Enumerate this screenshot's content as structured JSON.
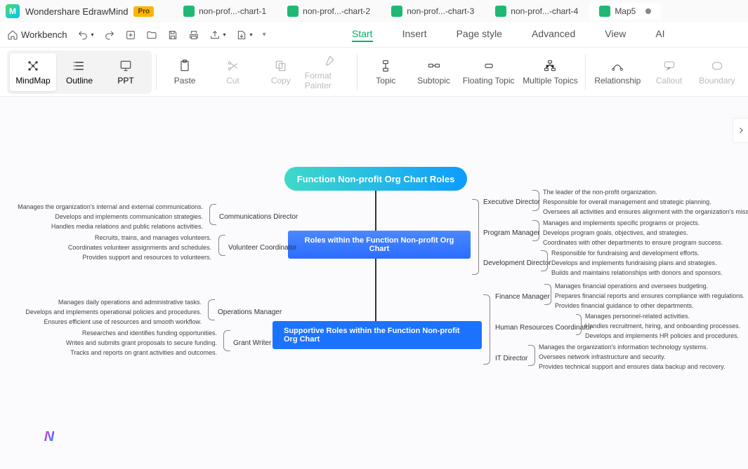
{
  "app": {
    "name": "Wondershare EdrawMind",
    "badge": "Pro"
  },
  "tabs": [
    {
      "label": "non-prof...-chart-1"
    },
    {
      "label": "non-prof...-chart-2"
    },
    {
      "label": "non-prof...-chart-3"
    },
    {
      "label": "non-prof...-chart-4"
    },
    {
      "label": "Map5",
      "active": true
    }
  ],
  "toolbar": {
    "workbench": "Workbench"
  },
  "menu": {
    "start": "Start",
    "insert": "Insert",
    "page_style": "Page style",
    "advanced": "Advanced",
    "view": "View",
    "ai": "AI"
  },
  "view_modes": {
    "mindmap": "MindMap",
    "outline": "Outline",
    "ppt": "PPT"
  },
  "ribbon": {
    "paste": "Paste",
    "cut": "Cut",
    "copy": "Copy",
    "format_painter": "Format Painter",
    "topic": "Topic",
    "subtopic": "Subtopic",
    "floating_topic": "Floating Topic",
    "multiple_topics": "Multiple Topics",
    "relationship": "Relationship",
    "callout": "Callout",
    "boundary": "Boundary"
  },
  "mindmap": {
    "root": "Function Non-profit Org Chart Roles",
    "branches": [
      {
        "title": "Roles within the Function Non-profit Org Chart",
        "left": [
          {
            "label": "Communications Director",
            "details": [
              "Manages the organization's internal and external communications.",
              "Develops and implements communication strategies.",
              "Handles media relations and public relations activities."
            ]
          },
          {
            "label": "Volunteer Coordinator",
            "details": [
              "Recruits, trains, and manages volunteers.",
              "Coordinates volunteer assignments and schedules.",
              "Provides support and resources to volunteers."
            ]
          }
        ],
        "right": [
          {
            "label": "Executive Director",
            "details": [
              "The leader of the non-profit organization.",
              "Responsible for overall management and strategic planning.",
              "Oversees all activities and ensures alignment with the organization's mission."
            ]
          },
          {
            "label": "Program Manager",
            "details": [
              "Manages and implements specific programs or projects.",
              "Develops program goals, objectives, and strategies.",
              "Coordinates with other departments to ensure program success."
            ]
          },
          {
            "label": "Development Director",
            "details": [
              "Responsible for fundraising and development efforts.",
              "Develops and implements fundraising plans and strategies.",
              "Builds and maintains relationships with donors and sponsors."
            ]
          }
        ]
      },
      {
        "title": "Supportive Roles within the Function Non-profit Org Chart",
        "left": [
          {
            "label": "Operations Manager",
            "details": [
              "Manages daily operations and administrative tasks.",
              "Develops and implements operational policies and procedures.",
              "Ensures efficient use of resources and smooth workflow."
            ]
          },
          {
            "label": "Grant Writer",
            "details": [
              "Researches and identifies funding opportunities.",
              "Writes and submits grant proposals to secure funding.",
              "Tracks and reports on grant activities and outcomes."
            ]
          }
        ],
        "right": [
          {
            "label": "Finance Manager",
            "details": [
              "Manages financial operations and oversees budgeting.",
              "Prepares financial reports and ensures compliance with regulations.",
              "Provides financial guidance to other departments."
            ]
          },
          {
            "label": "Human Resources Coordinator",
            "details": [
              "Manages personnel-related activities.",
              "Handles recruitment, hiring, and onboarding processes.",
              "Develops and implements HR policies and procedures."
            ]
          },
          {
            "label": "IT Director",
            "details": [
              "Manages the organization's information technology systems.",
              "Oversees network infrastructure and security.",
              "Provides technical support and ensures data backup and recovery."
            ]
          }
        ]
      }
    ]
  }
}
